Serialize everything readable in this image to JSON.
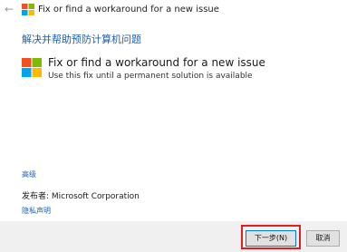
{
  "window": {
    "back_icon": "back-arrow-icon",
    "app_icon": "windows-logo-icon",
    "title": "Fix or find a workaround for a new issue"
  },
  "main": {
    "heading": "解决并帮助预防计算机问题",
    "option": {
      "icon": "windows-logo-icon",
      "title": "Fix or find a workaround for a new issue",
      "description": "Use this fix until a permanent solution is available"
    },
    "advanced_link": "高级",
    "publisher": "发布者:  Microsoft Corporation",
    "privacy_link": "隐私声明"
  },
  "footer": {
    "next_label": "下一步(N)",
    "cancel_label": "取消"
  },
  "colors": {
    "logo_red": "#f25022",
    "logo_green": "#7fba00",
    "logo_blue": "#00a4ef",
    "logo_yellow": "#ffb900",
    "link_blue": "#1e5fb0",
    "highlight_red": "#e02020"
  }
}
